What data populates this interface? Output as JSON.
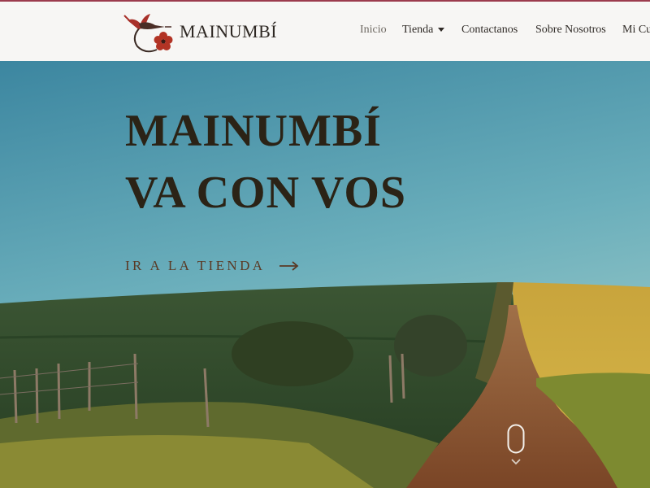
{
  "header": {
    "brand": "MAINUMBÍ",
    "nav": [
      {
        "label": "Inicio",
        "active": true
      },
      {
        "label": "Tienda",
        "has_dropdown": true
      },
      {
        "label": "Contactanos"
      },
      {
        "label": "Sobre Nosotros"
      },
      {
        "label": "Mi Cu"
      }
    ]
  },
  "hero": {
    "title_line1": "MAINUMBÍ",
    "title_line2": "VA CON VOS",
    "cta_label": "IR A LA TIENDA",
    "cta_icon": "arrow-right-icon",
    "scroll_icon": "mouse-scroll-icon"
  },
  "colors": {
    "accent_line": "#9b3b4d",
    "header_bg": "#f7f6f4",
    "title": "#2b2316",
    "cta": "#5a3a25",
    "sky_top": "#3f8aa0",
    "field_green": "#2f4a2a",
    "field_yellow": "#c9a93a",
    "dirt_road": "#8a5632"
  }
}
